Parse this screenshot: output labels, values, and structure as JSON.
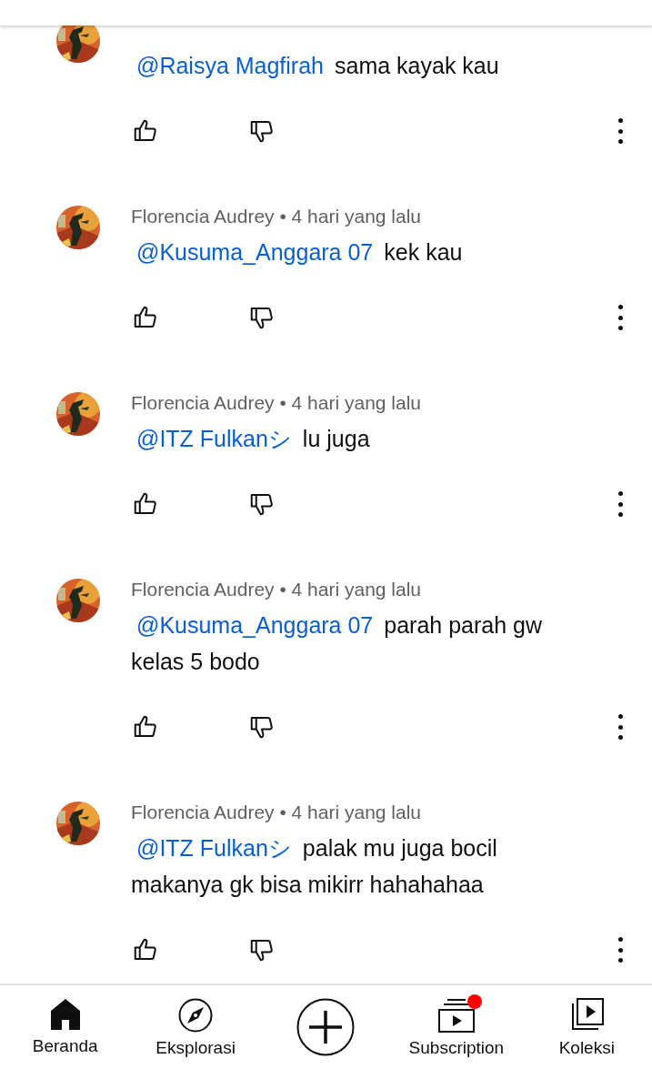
{
  "comments": [
    {
      "mention": "@Raisya Magfirah",
      "text": "sama kayak kau"
    },
    {
      "meta": "Florencia Audrey • 4 hari yang lalu",
      "mention": "@Kusuma_Anggara 07",
      "text": "kek kau"
    },
    {
      "meta": "Florencia Audrey • 4 hari yang lalu",
      "mention": "@ITZ Fulkanシ",
      "text": "lu juga"
    },
    {
      "meta": "Florencia Audrey • 4 hari yang lalu",
      "mention": "@Kusuma_Anggara 07",
      "text": "parah parah gw kelas 5 bodo"
    },
    {
      "meta": "Florencia Audrey • 4 hari yang lalu",
      "mention": "@ITZ Fulkanシ",
      "text": "palak mu juga bocil makanya gk bisa mikirr hahahahaa"
    }
  ],
  "nav": [
    {
      "kind": "home",
      "label": "Beranda"
    },
    {
      "kind": "explore",
      "label": "Eksplorasi"
    },
    {
      "kind": "create"
    },
    {
      "kind": "subscriptions",
      "label": "Subscription",
      "notification_dot": true
    },
    {
      "kind": "library",
      "label": "Koleksi"
    }
  ]
}
